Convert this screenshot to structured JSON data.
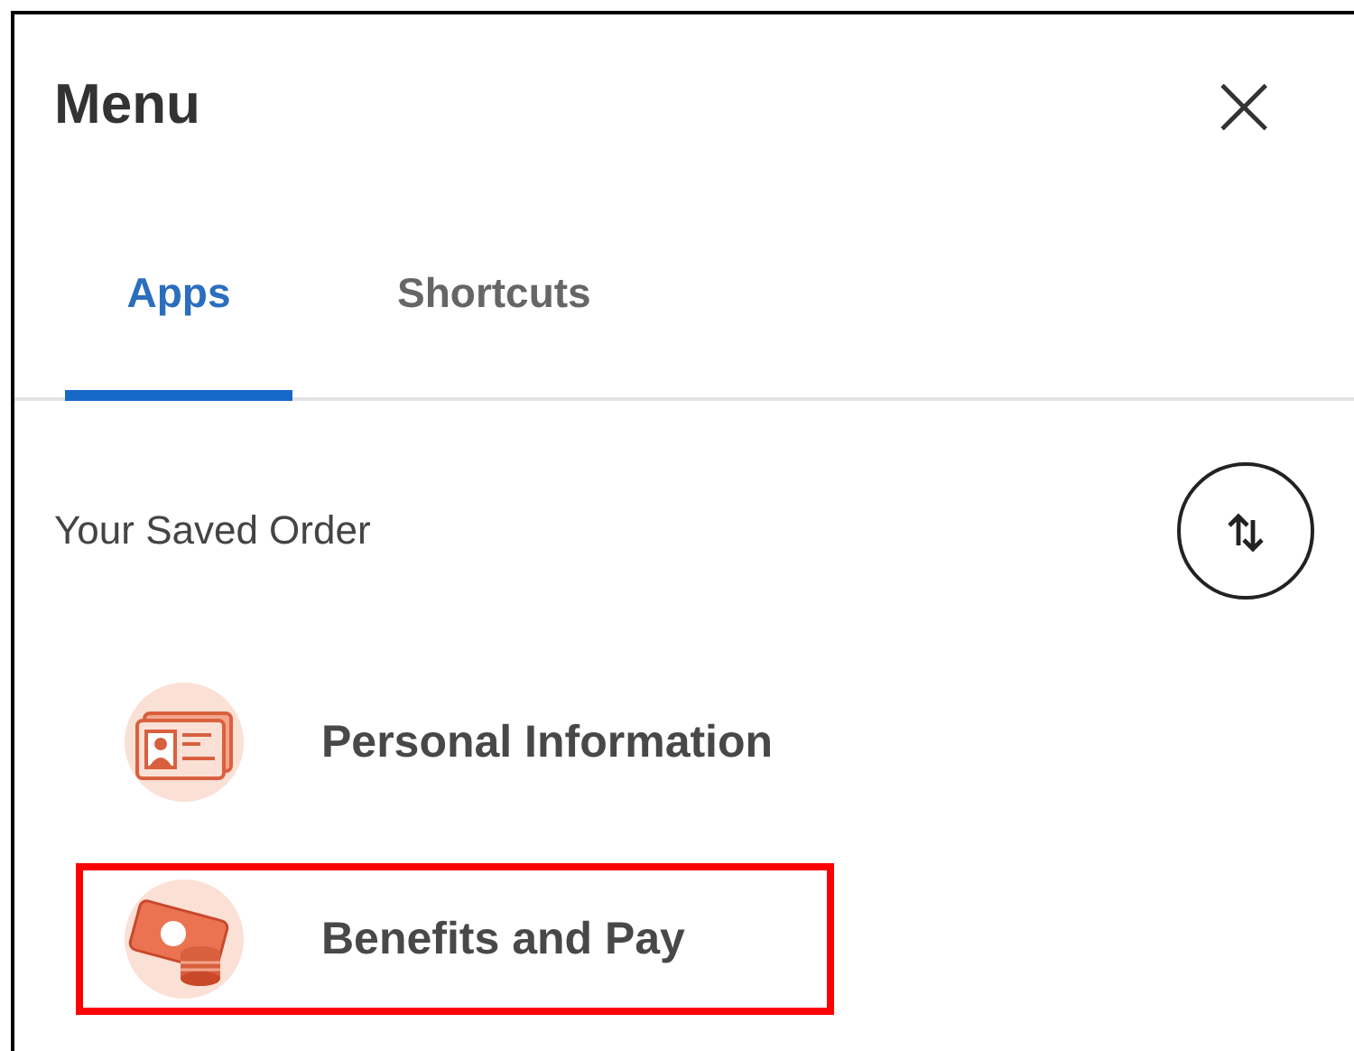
{
  "header": {
    "title": "Menu",
    "close": "×"
  },
  "tabs": [
    {
      "label": "Apps",
      "selected": true
    },
    {
      "label": "Shortcuts",
      "selected": false
    }
  ],
  "section": {
    "label": "Your Saved Order"
  },
  "apps": [
    {
      "label": "Personal Information",
      "kind": "idcard",
      "highlighted": false
    },
    {
      "label": "Benefits and Pay",
      "kind": "money",
      "highlighted": true
    }
  ]
}
